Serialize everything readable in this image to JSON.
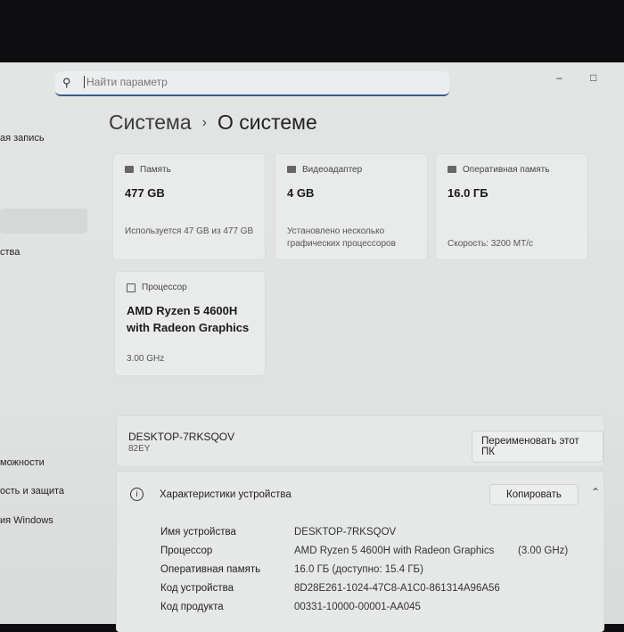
{
  "search": {
    "placeholder": "Найти параметр"
  },
  "window": {
    "minimize": "–",
    "maximize": "□"
  },
  "breadcrumb": {
    "parent": "Система",
    "separator": "›",
    "current": "О системе"
  },
  "sidebar": {
    "items": [
      "ая запись",
      "ства",
      "можности",
      "ость и защита",
      "ия Windows"
    ]
  },
  "cards": [
    {
      "label": "Память",
      "value": "477 GB",
      "sub": "Используется 47 GB из 477 GB"
    },
    {
      "label": "Видеоадаптер",
      "value": "4 GB",
      "sub": "Установлено несколько графических процессоров"
    },
    {
      "label": "Оперативная память",
      "value": "16.0 ГБ",
      "sub": "Скорость: 3200 МТ/с"
    },
    {
      "label": "Процессор",
      "value": "AMD Ryzen 5 4600H with Radeon Graphics",
      "sub": "3.00 GHz"
    }
  ],
  "device": {
    "name": "DESKTOP-7RKSQOV",
    "model": "82EY",
    "rename_button": "Переименовать этот ПК"
  },
  "specs": {
    "title": "Характеристики устройства",
    "copy_button": "Копировать",
    "rows": [
      {
        "label": "Имя устройства",
        "value": "DESKTOP-7RKSQOV",
        "extra": ""
      },
      {
        "label": "Процессор",
        "value": "AMD Ryzen 5 4600H with Radeon Graphics",
        "extra": "(3.00 GHz)"
      },
      {
        "label": "Оперативная память",
        "value": "16.0 ГБ (доступно: 15.4 ГБ)",
        "extra": ""
      },
      {
        "label": "Код устройства",
        "value": "8D28E261-1024-47C8-A1C0-861314A96A56",
        "extra": ""
      },
      {
        "label": "Код продукта",
        "value": "00331-10000-00001-AA045",
        "extra": ""
      }
    ]
  }
}
